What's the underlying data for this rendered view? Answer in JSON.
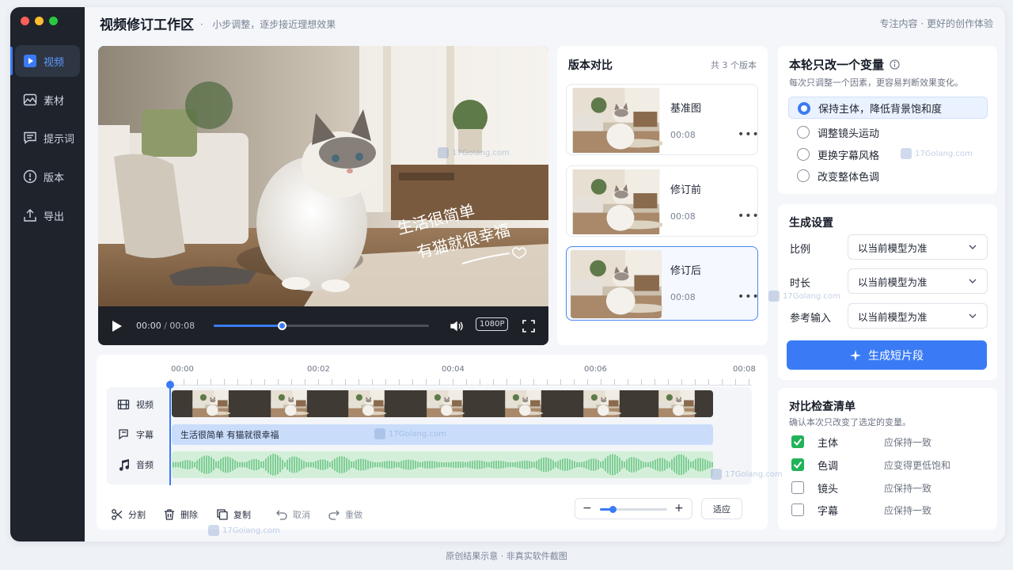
{
  "window": {
    "traffic_lights": [
      "#ff5f57",
      "#febc2e",
      "#28c840"
    ]
  },
  "sidebar": {
    "items": [
      {
        "label": "视频",
        "icon": "video-play-icon",
        "active": true
      },
      {
        "label": "素材",
        "icon": "image-icon",
        "active": false
      },
      {
        "label": "提示词",
        "icon": "chat-text-icon",
        "active": false
      },
      {
        "label": "版本",
        "icon": "info-circle-icon",
        "active": false
      },
      {
        "label": "导出",
        "icon": "upload-icon",
        "active": false
      }
    ]
  },
  "header": {
    "title": "视频修订工作区",
    "subtitle": "小步调整，逐步接近理想效果",
    "right_text": "专注内容 · 更好的创作体验"
  },
  "player": {
    "overlay_line1": "生活很简单",
    "overlay_line2": "有猫就很幸福",
    "current_time": "00:00",
    "separator": "/",
    "duration": "00:08",
    "quality": "1080P",
    "progress": 0.37
  },
  "versions": {
    "title": "版本对比",
    "count_text": "共 3 个版本",
    "items": [
      {
        "name": "基准图",
        "time": "00:08",
        "selected": false
      },
      {
        "name": "修订前",
        "time": "00:08",
        "selected": false
      },
      {
        "name": "修订后",
        "time": "00:08",
        "selected": true
      }
    ]
  },
  "variable": {
    "title": "本轮只改一个变量",
    "subtitle": "每次只调整一个因素，更容易判断效果变化。",
    "options": [
      {
        "label": "保持主体，降低背景饱和度",
        "selected": true
      },
      {
        "label": "调整镜头运动",
        "selected": false
      },
      {
        "label": "更换字幕风格",
        "selected": false
      },
      {
        "label": "改变整体色调",
        "selected": false
      }
    ]
  },
  "settings": {
    "title": "生成设置",
    "rows": [
      {
        "label": "比例",
        "value": "以当前模型为准"
      },
      {
        "label": "时长",
        "value": "以当前模型为准"
      },
      {
        "label": "参考输入",
        "value": "以当前模型为准"
      }
    ],
    "generate_label": "生成短片段"
  },
  "checklist": {
    "title": "对比检查清单",
    "subtitle": "确认本次只改变了选定的变量。",
    "items": [
      {
        "name": "主体",
        "value": "应保持一致",
        "checked": true
      },
      {
        "name": "色调",
        "value": "应变得更低饱和",
        "checked": true
      },
      {
        "name": "镜头",
        "value": "应保持一致",
        "checked": false
      },
      {
        "name": "字幕",
        "value": "应保持一致",
        "checked": false
      }
    ]
  },
  "timeline": {
    "ticks": [
      "00:00",
      "00:02",
      "00:04",
      "00:06",
      "00:08"
    ],
    "tracks": [
      {
        "label": "视频",
        "icon": "film-icon"
      },
      {
        "label": "字幕",
        "icon": "subtitle-icon"
      },
      {
        "label": "音频",
        "icon": "music-note-icon"
      }
    ],
    "subtitle_clip_text": "生活很简单 有猫就很幸福",
    "tools": [
      {
        "label": "分割",
        "icon": "scissors-icon"
      },
      {
        "label": "删除",
        "icon": "trash-icon"
      },
      {
        "label": "复制",
        "icon": "copy-icon"
      },
      {
        "label": "取消",
        "icon": "undo-icon"
      },
      {
        "label": "重做",
        "icon": "redo-icon"
      }
    ],
    "zoom_minus": "−",
    "zoom_plus": "+",
    "zoom_level": 0.2,
    "fit_label": "适应"
  },
  "watermark": "17Golang.com",
  "footer": "原创结果示意 · 非真实软件截图",
  "colors": {
    "accent": "#3a7bf5",
    "check": "#22b35a",
    "sidebar_bg": "#1f232b"
  }
}
